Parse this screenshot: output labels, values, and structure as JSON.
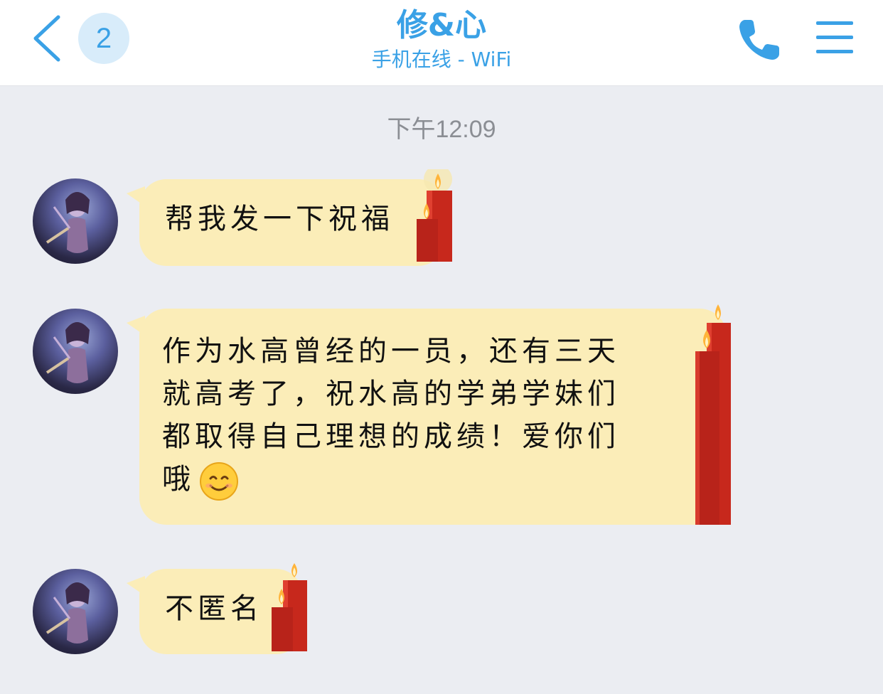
{
  "header": {
    "back_label": "<",
    "unread_count": "2",
    "title": "修&心",
    "subtitle": "手机在线 - WiFi",
    "accent_color": "#3aa1e6",
    "call_icon": "phone-icon",
    "menu_icon": "menu-icon"
  },
  "chat": {
    "timestamp": "下午12:09",
    "bubble_color": "#fbedb8",
    "messages": [
      {
        "sender": "修&心",
        "text": "帮我发一下祝福",
        "decoration": "candle-icon"
      },
      {
        "sender": "修&心",
        "text": "作为水高曾经的一员，还有三天\n就高考了，祝水高的学弟学妹们\n都取得自己理想的成绩！爱你们\n哦",
        "emoji": "smile-emoji-icon",
        "decoration": "candle-icon"
      },
      {
        "sender": "修&心",
        "text": "不匿名",
        "decoration": "candle-icon"
      }
    ]
  }
}
